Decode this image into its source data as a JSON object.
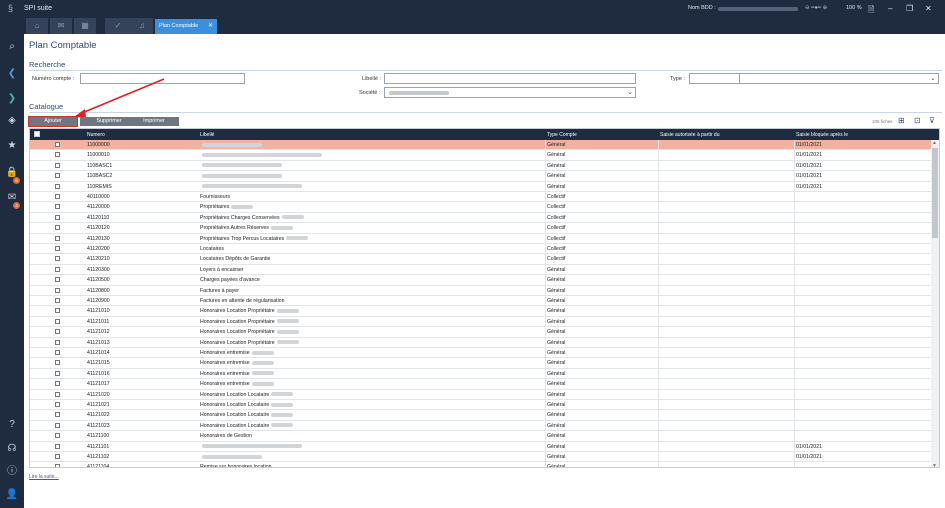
{
  "app": {
    "title": "SPI suite",
    "bdd_label": "Nom BDD :",
    "zoom": "100 %"
  },
  "tabs": {
    "active_label": "Plan Comptable",
    "close_glyph": "✕"
  },
  "page": {
    "title": "Plan Comptable"
  },
  "recherche": {
    "title": "Recherche",
    "numero_label": "Numéro compte :",
    "libelle_label": "Libellé :",
    "societe_label": "Société :",
    "type_label": "Type :"
  },
  "catalogue": {
    "title": "Catalogue",
    "btn_ajouter": "Ajouter",
    "btn_supprimer": "Supprimer",
    "btn_imprimer": "Imprimer",
    "count": "105 fiches"
  },
  "grid": {
    "columns": [
      "Numero",
      "Libellé",
      "Type Compte",
      "Saisie autorisée à partir du",
      "Saisie bloquée après le"
    ],
    "rows": [
      {
        "numero": "11000000",
        "libelle": "",
        "type": "Général",
        "bloque": "01/01/2021",
        "selected": true
      },
      {
        "numero": "11000010",
        "libelle": "",
        "type": "Général",
        "bloque": "01/01/2021"
      },
      {
        "numero": "110BASC1",
        "libelle": "",
        "type": "Général",
        "bloque": "01/01/2021"
      },
      {
        "numero": "110BASC2",
        "libelle": "",
        "type": "Général",
        "bloque": "01/01/2021"
      },
      {
        "numero": "110REMIS",
        "libelle": "",
        "type": "Général",
        "bloque": "01/01/2021"
      },
      {
        "numero": "40110000",
        "libelle": "Fournisseurs",
        "type": "Collectif",
        "bloque": ""
      },
      {
        "numero": "41120000",
        "libelle": "Propriétaires",
        "type": "Collectif",
        "bloque": ""
      },
      {
        "numero": "41120110",
        "libelle": "Propriétaires Charges Conservées",
        "type": "Collectif",
        "bloque": ""
      },
      {
        "numero": "41120120",
        "libelle": "Propriétaires Autres Réserves",
        "type": "Collectif",
        "bloque": ""
      },
      {
        "numero": "41120130",
        "libelle": "Propriétaires Trop Percus Locataires",
        "type": "Collectif",
        "bloque": ""
      },
      {
        "numero": "41120200",
        "libelle": "Locataires",
        "type": "Collectif",
        "bloque": ""
      },
      {
        "numero": "41120210",
        "libelle": "Locataires Dépôts de Garantie",
        "type": "Collectif",
        "bloque": ""
      },
      {
        "numero": "41120300",
        "libelle": "Loyers à encaisser",
        "type": "Général",
        "bloque": ""
      },
      {
        "numero": "41120500",
        "libelle": "Charges payées d'avance",
        "type": "Général",
        "bloque": ""
      },
      {
        "numero": "41120800",
        "libelle": "Factures à payer",
        "type": "Général",
        "bloque": ""
      },
      {
        "numero": "41120900",
        "libelle": "Factures en attente de régularisation",
        "type": "Général",
        "bloque": ""
      },
      {
        "numero": "41121010",
        "libelle": "Honoraires Location Propriétaire",
        "type": "Général",
        "bloque": ""
      },
      {
        "numero": "41121011",
        "libelle": "Honoraires Location Propriétaire",
        "type": "Général",
        "bloque": ""
      },
      {
        "numero": "41121012",
        "libelle": "Honoraires Location Propriétaire",
        "type": "Général",
        "bloque": ""
      },
      {
        "numero": "41121013",
        "libelle": "Honoraires Location Propriétaire",
        "type": "Général",
        "bloque": ""
      },
      {
        "numero": "41121014",
        "libelle": "Honoraires entremise",
        "type": "Général",
        "bloque": ""
      },
      {
        "numero": "41121015",
        "libelle": "Honoraires entremise",
        "type": "Général",
        "bloque": ""
      },
      {
        "numero": "41121016",
        "libelle": "Honoraires entremise",
        "type": "Général",
        "bloque": ""
      },
      {
        "numero": "41121017",
        "libelle": "Honoraires entremise",
        "type": "Général",
        "bloque": ""
      },
      {
        "numero": "41121020",
        "libelle": "Honoraires Location Locataire",
        "type": "Général",
        "bloque": ""
      },
      {
        "numero": "41121021",
        "libelle": "Honoraires Location Locataire",
        "type": "Général",
        "bloque": ""
      },
      {
        "numero": "41121022",
        "libelle": "Honoraires Location Locataire",
        "type": "Général",
        "bloque": ""
      },
      {
        "numero": "41121023",
        "libelle": "Honoraires Location Locataire",
        "type": "Général",
        "bloque": ""
      },
      {
        "numero": "41121100",
        "libelle": "Honoraires de Gestion",
        "type": "Général",
        "bloque": ""
      },
      {
        "numero": "41121101",
        "libelle": "",
        "type": "Général",
        "bloque": "01/01/2021"
      },
      {
        "numero": "41121102",
        "libelle": "",
        "type": "Général",
        "bloque": "01/01/2021"
      },
      {
        "numero": "41121104",
        "libelle": "Remise sur honoraires location",
        "type": "Général",
        "bloque": ""
      }
    ]
  },
  "footer": {
    "lire_suite": "Lire la suite..."
  },
  "icons": {
    "app_logo": "spi-logo-icon",
    "annotation_color": "#e02020"
  }
}
